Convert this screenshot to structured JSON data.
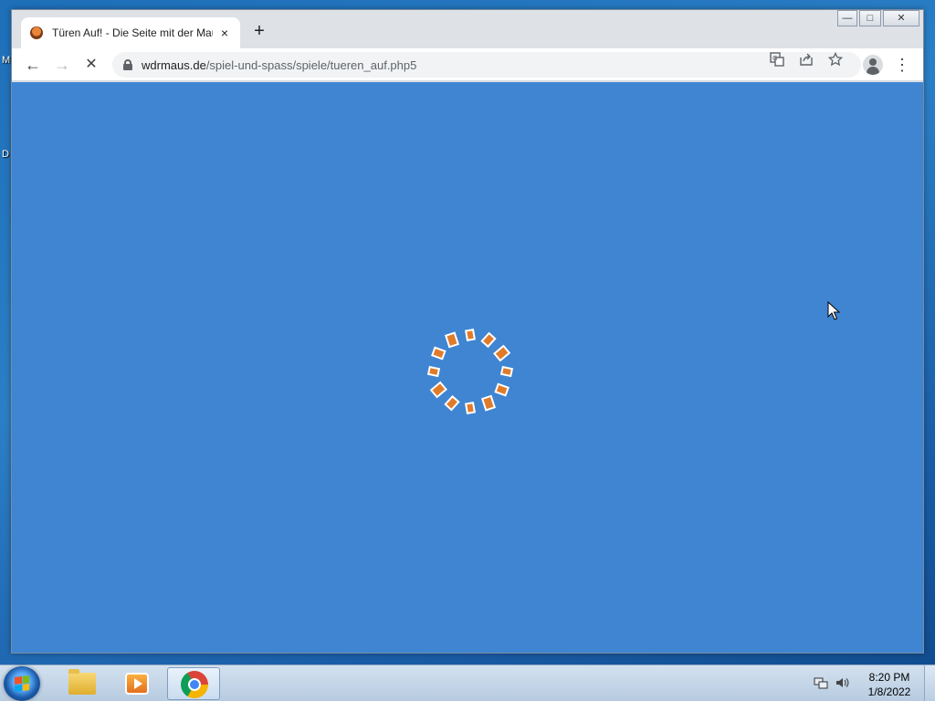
{
  "desktop": {
    "label_1": "M",
    "label_2": "D"
  },
  "browser": {
    "tab": {
      "title": "Türen Auf! - Die Seite mit der Maus",
      "close_glyph": "×"
    },
    "new_tab_glyph": "+",
    "window_controls": {
      "minimize": "—",
      "maximize": "□",
      "close": "✕"
    },
    "toolbar": {
      "back_glyph": "←",
      "forward_glyph": "→",
      "stop_glyph": "✕",
      "menu_glyph": "⋮"
    },
    "address": {
      "host": "wdrmaus.de",
      "path": "/spiel-und-spass/spiele/tueren_auf.php5"
    },
    "icons": [
      "lock-icon",
      "translate-icon",
      "share-icon",
      "star-icon",
      "profile-icon",
      "menu-icon"
    ]
  },
  "page": {
    "background_color": "#3f85d2",
    "spinner_color": "#e07b2a"
  },
  "taskbar": {
    "items": [
      "start-button",
      "file-explorer",
      "media-player",
      "chrome"
    ],
    "clock": {
      "time": "8:20 PM",
      "date": "1/8/2022"
    }
  }
}
